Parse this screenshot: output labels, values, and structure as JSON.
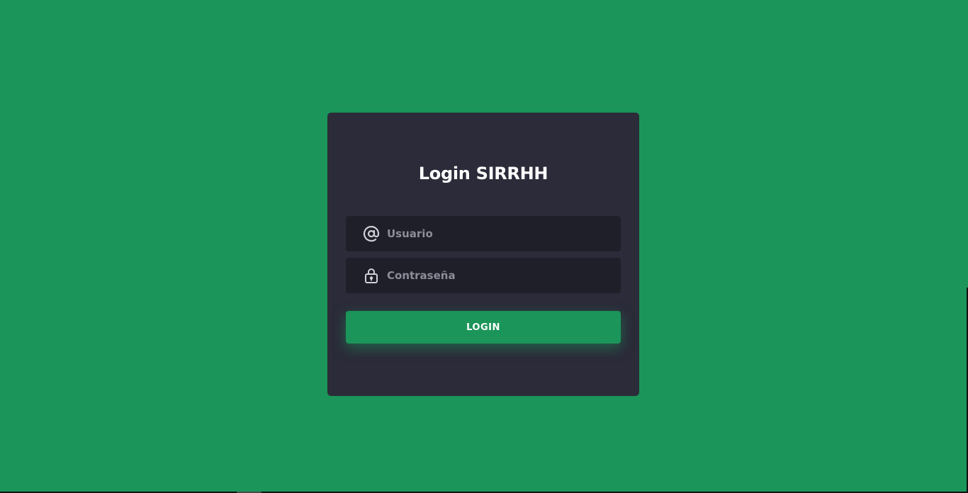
{
  "page": {
    "background_color": "#1b9559"
  },
  "login_card": {
    "background_color": "#2b2b39",
    "title": "Login SIRRHH",
    "username": {
      "icon": "at-sign-icon",
      "placeholder": "Usuario",
      "value": ""
    },
    "password": {
      "icon": "lock-icon",
      "placeholder": "Contraseña",
      "value": ""
    },
    "submit_label": "LOGIN",
    "accent_color": "#1b9559"
  }
}
